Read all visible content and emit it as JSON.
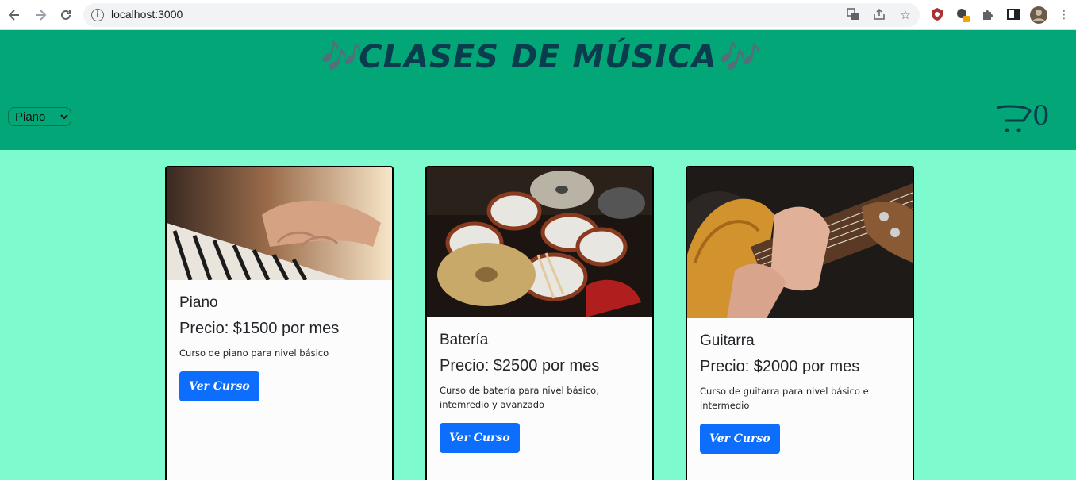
{
  "browser": {
    "url": "localhost:3000",
    "icons": [
      "back-icon",
      "forward-icon",
      "reload-icon",
      "info-icon",
      "translate-icon",
      "share-icon",
      "star-icon",
      "extension-shield-icon",
      "extension-alert-icon",
      "puzzle-icon",
      "side-panel-icon",
      "profile-avatar",
      "kebab-menu-icon"
    ]
  },
  "header": {
    "title": "🎶CLASES DE MÚSICA🎶",
    "select_value": "Piano",
    "cart_count": "0",
    "bg_color": "#02a677",
    "title_color": "#0b3c4e"
  },
  "page": {
    "bg_color": "#7dfbce"
  },
  "cards": [
    {
      "title": "Piano",
      "price": "Precio: $1500 por mes",
      "description": "Curso de piano para nivel básico",
      "button": "Ver Curso",
      "image_alt": "piano-photo"
    },
    {
      "title": "Batería",
      "price": "Precio: $2500 por mes",
      "description": "Curso de batería para nivel básico, intemredio y avanzado",
      "button": "Ver Curso",
      "image_alt": "drum-kit-photo"
    },
    {
      "title": "Guitarra",
      "price": "Precio: $2000 por mes",
      "description": "Curso de guitarra para nivel básico e intermedio",
      "button": "Ver Curso",
      "image_alt": "guitar-photo"
    }
  ]
}
